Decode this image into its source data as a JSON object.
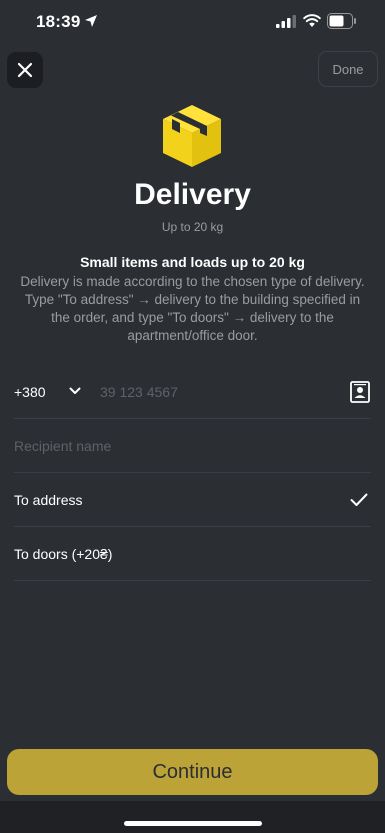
{
  "status_bar": {
    "time": "18:39"
  },
  "header": {
    "done_label": "Done",
    "title": "Delivery",
    "subtitle": "Up to 20 kg",
    "headline": "Small items and loads up to 20 kg",
    "description": "Delivery is made according to the chosen type of delivery. Type \"To address\" → delivery to the building specified in the order, and type \"To doors\" → delivery to the apartment/office door."
  },
  "form": {
    "country_code": "+380",
    "phone_placeholder": "39 123 4567",
    "phone_value": "",
    "name_placeholder": "Recipient name",
    "name_value": "",
    "options": [
      {
        "label": "To address",
        "selected": true
      },
      {
        "label": "To doors (+20₴)",
        "selected": false
      }
    ]
  },
  "footer": {
    "continue_label": "Continue"
  },
  "colors": {
    "background": "#2b2e33",
    "accent": "#bca338",
    "icon_yellow": "#f2d21b",
    "muted_text": "#9a9ca1"
  },
  "icons": [
    "location-arrow-icon",
    "signal-icon",
    "wifi-icon",
    "battery-icon",
    "close-icon",
    "package-box-icon",
    "chevron-down-icon",
    "contacts-icon",
    "check-icon"
  ]
}
